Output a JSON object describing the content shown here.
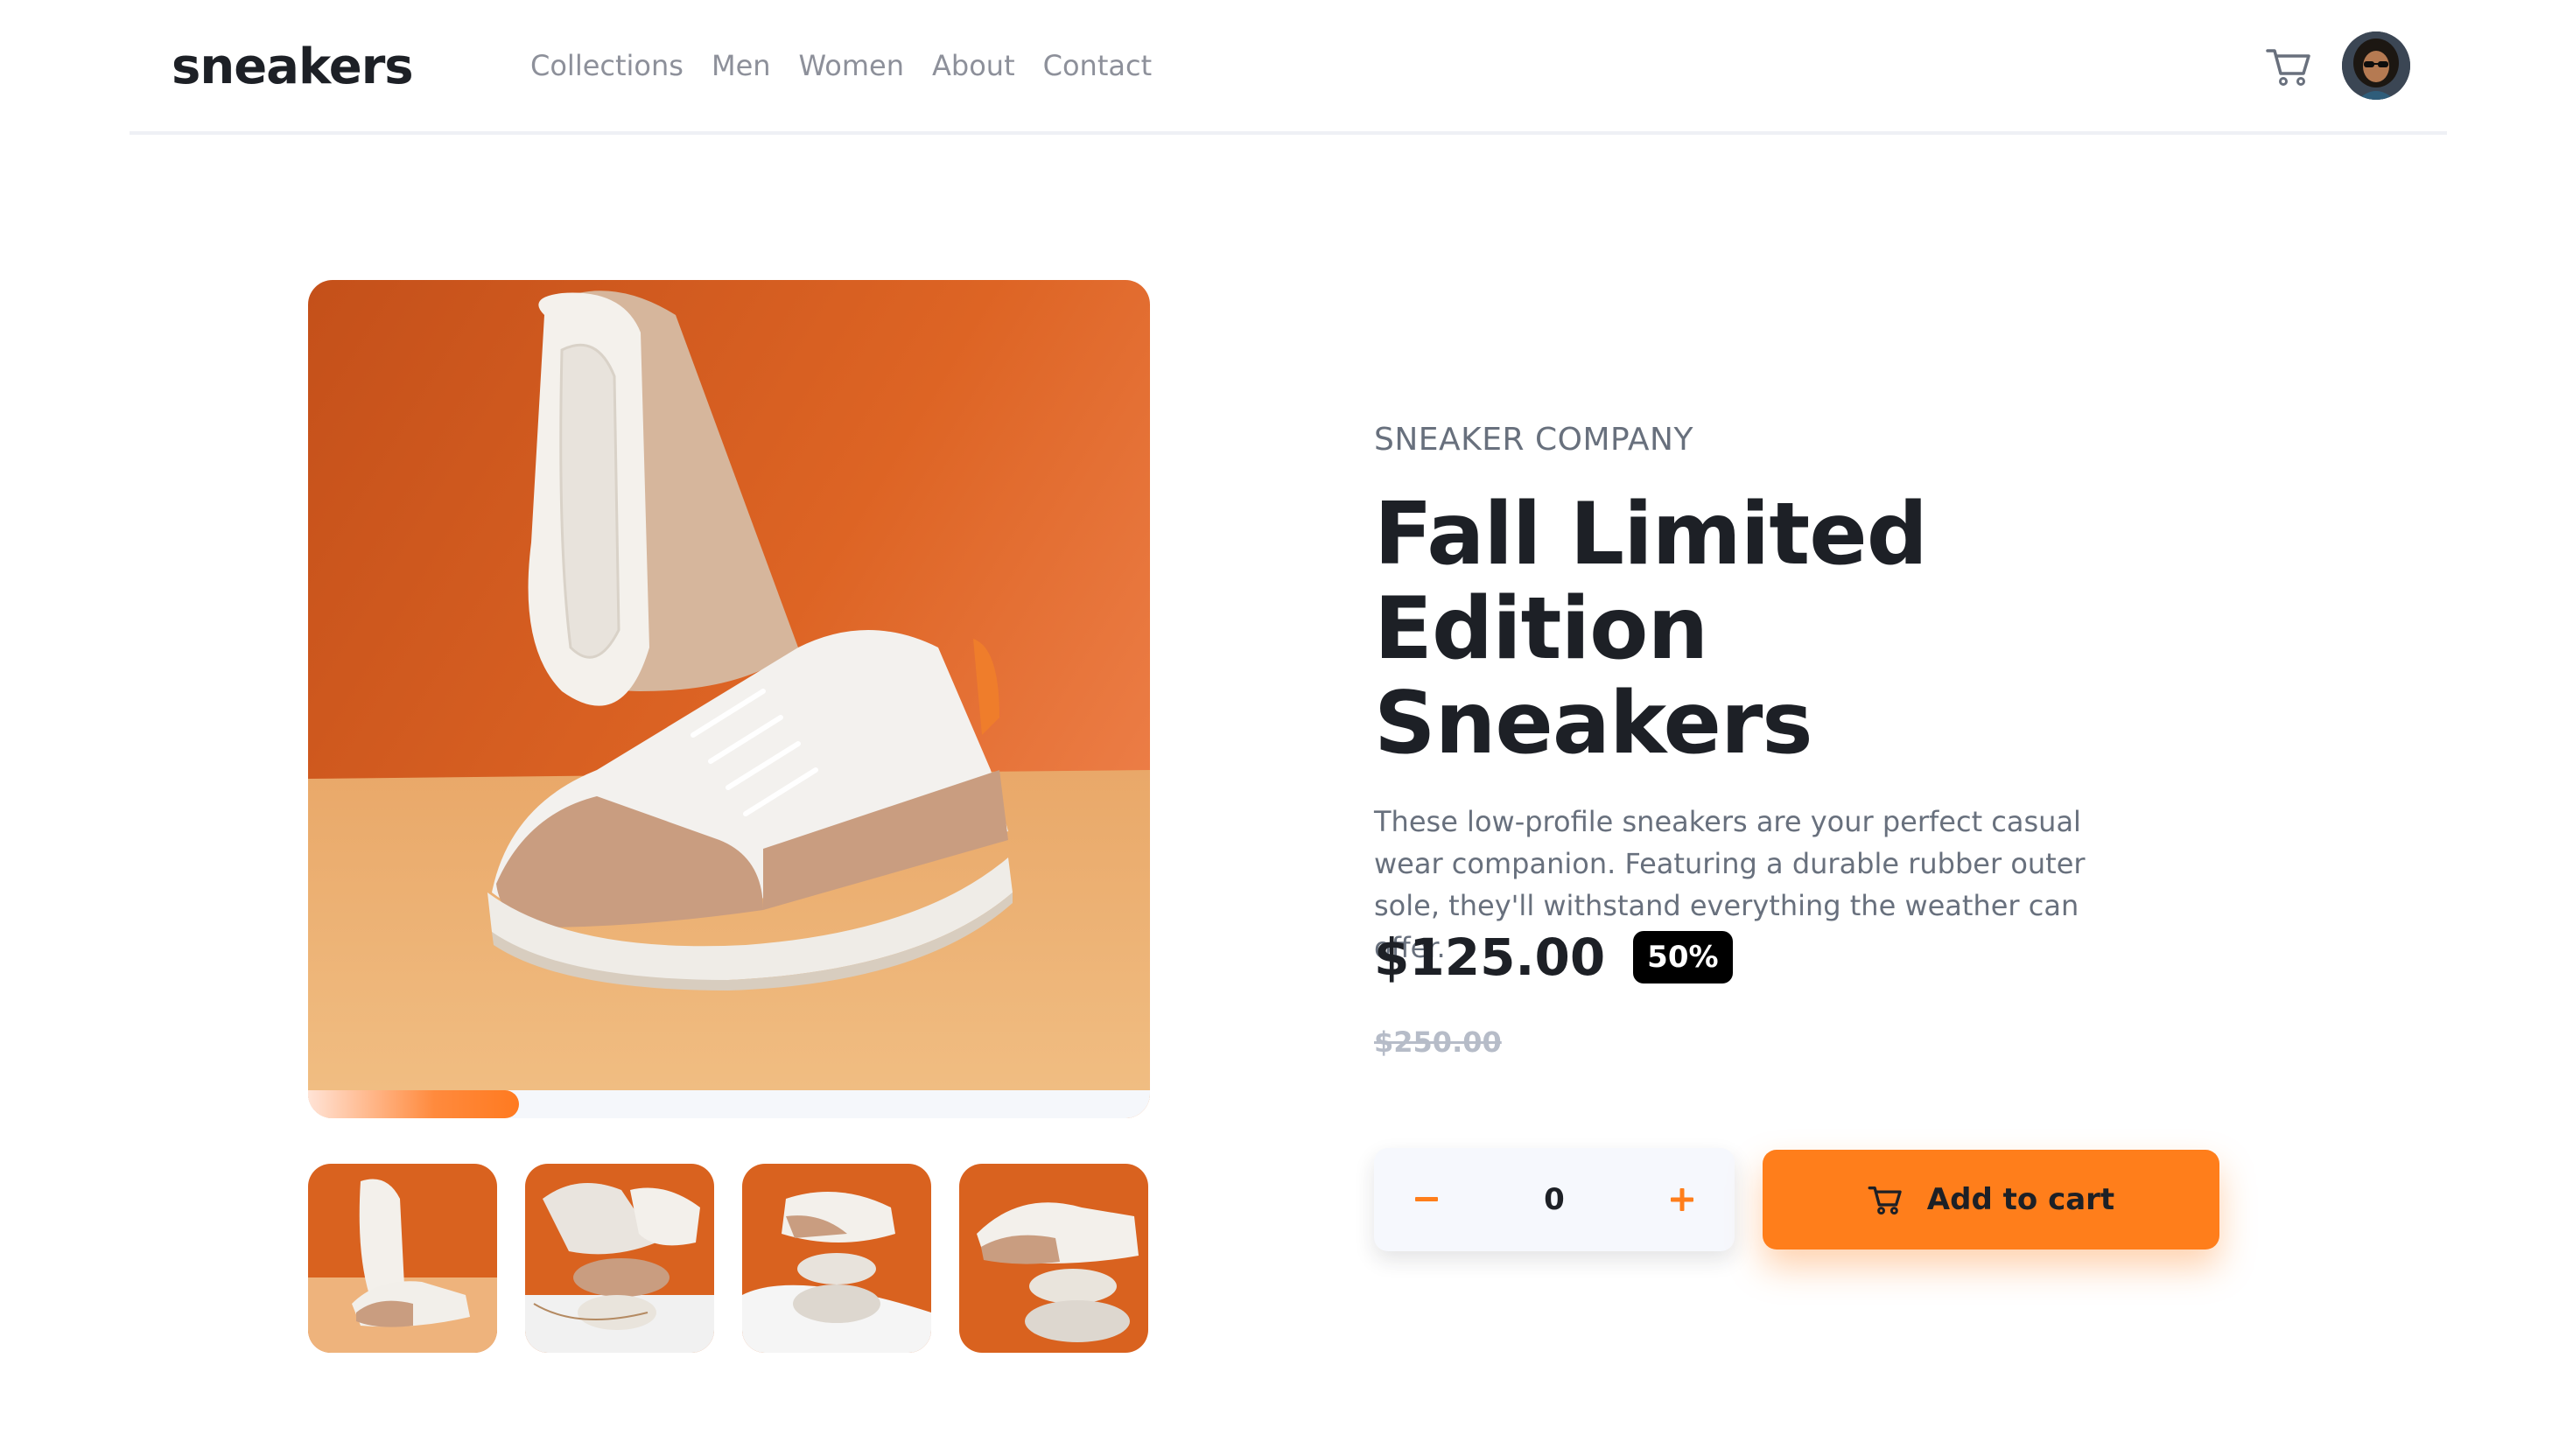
{
  "brand": {
    "logo": "sneakers"
  },
  "nav": [
    {
      "label": "Collections"
    },
    {
      "label": "Men"
    },
    {
      "label": "Women"
    },
    {
      "label": "About"
    },
    {
      "label": "Contact"
    }
  ],
  "header_icons": {
    "cart": "cart-icon",
    "avatar": "user-avatar"
  },
  "gallery": {
    "progress": 0.25,
    "thumbnails_count": 4
  },
  "product": {
    "company": "SNEAKER COMPANY",
    "title_line1": "Fall Limited Edition",
    "title_line2": "Sneakers",
    "description": "These low-profile sneakers are your perfect casual wear companion. Featuring a durable rubber outer sole, they'll withstand everything the weather can offer.",
    "price": "$125.00",
    "discount": "50%",
    "original_price": "$250.00"
  },
  "quantity": {
    "minus": "−",
    "value": "0",
    "plus": "+"
  },
  "cta": {
    "label": "Add to cart",
    "icon": "cart-icon"
  },
  "colors": {
    "accent": "#ff7e1b",
    "dark": "#1d2026",
    "muted": "#68707d",
    "light": "#f6f8fd"
  }
}
